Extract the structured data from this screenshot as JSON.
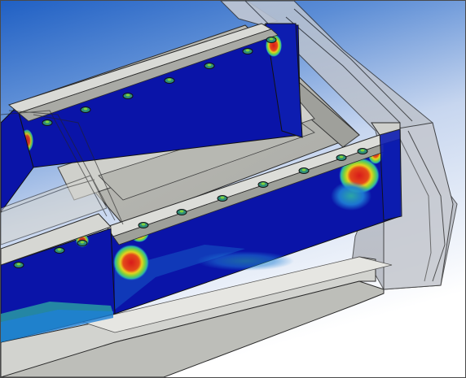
{
  "viewport": {
    "kind": "3D finite-element stress contour view",
    "background_top": "#1f5fbf",
    "background_bottom": "#ffffff",
    "legend_visible": false,
    "axes_triad_visible": false
  },
  "colors": {
    "low": "#0a14a8",
    "low_mid": "#1e7fd6",
    "mid": "#2fb6a3",
    "mid_high": "#7fd23a",
    "high_mid": "#e8d020",
    "high": "#d81a1a",
    "housing": "#b8bcc4",
    "edge": "#2a2a2a"
  },
  "icons": {
    "bolt_head": "bolt-icon"
  }
}
